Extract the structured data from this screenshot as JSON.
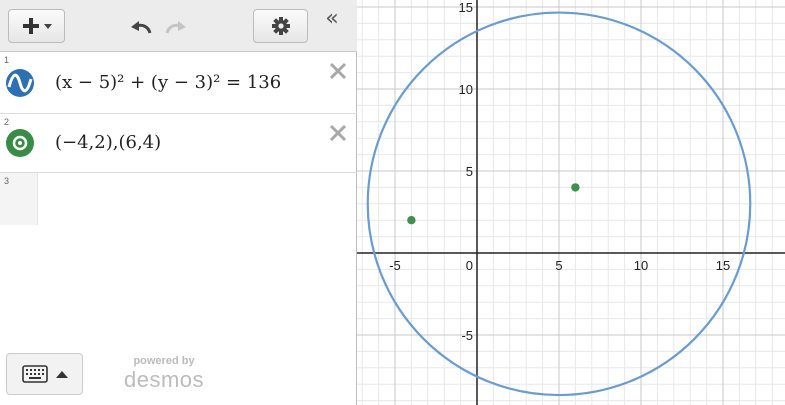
{
  "toolbar": {
    "add_icon": "plus-icon",
    "undo_icon": "undo-icon",
    "redo_icon": "redo-icon",
    "settings_icon": "gear-icon",
    "collapse_label": "«"
  },
  "expressions": [
    {
      "number": "1",
      "type": "graph",
      "icon": "wave-icon",
      "color": "#2d70b3",
      "latex": "(x − 5)² + (y − 3)² = 136"
    },
    {
      "number": "2",
      "type": "points",
      "icon": "point-icon",
      "color": "#388c46",
      "latex": "(−4,2),(6,4)"
    },
    {
      "number": "3",
      "type": "empty",
      "latex": ""
    }
  ],
  "footer": {
    "keyboard_icon": "keyboard-icon",
    "powered_by": "powered by",
    "brand": "desmos"
  },
  "graph": {
    "xlim": [
      -7,
      19
    ],
    "ylim": [
      -9,
      15
    ],
    "grid": true,
    "x_ticks": [
      -5,
      5,
      10,
      15
    ],
    "y_ticks": [
      -5,
      5,
      10,
      15
    ],
    "origin_label": "0",
    "circle": {
      "center": [
        5,
        3
      ],
      "r_squared": 136,
      "color": "#6a9ccf"
    },
    "points": [
      {
        "x": -4,
        "y": 2,
        "color": "#3f8f4e"
      },
      {
        "x": 6,
        "y": 4,
        "color": "#3f8f4e"
      }
    ]
  }
}
